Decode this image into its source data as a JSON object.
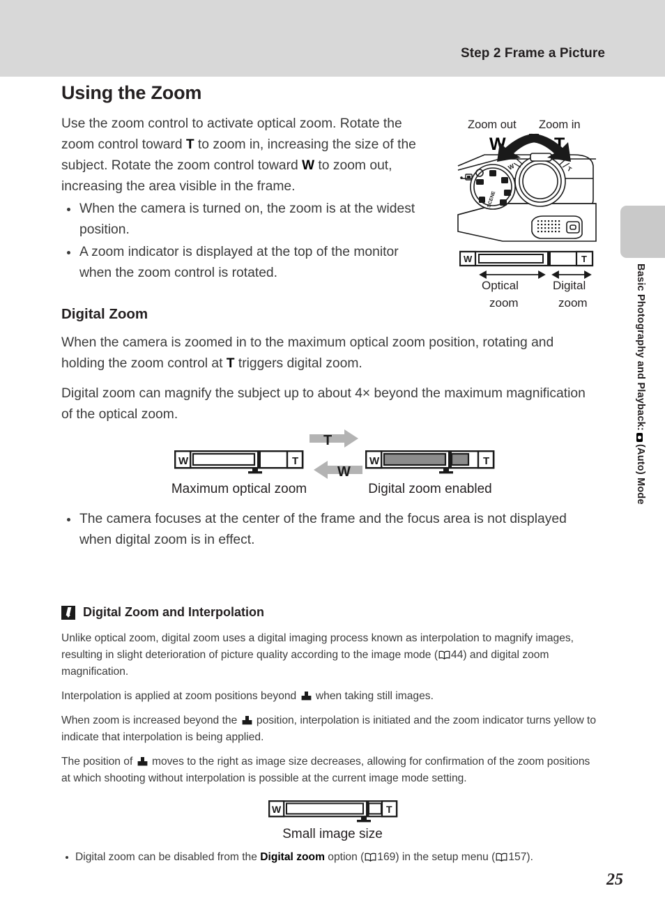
{
  "header": {
    "title": "Step 2 Frame a Picture"
  },
  "sidebar": {
    "chapter_pre": "Basic Photography and Playback: ",
    "chapter_post": " (Auto) Mode",
    "camera_icon": "camera-auto-icon"
  },
  "page": {
    "number": "25"
  },
  "main": {
    "section_title": "Using the Zoom",
    "intro": {
      "part1": "Use the zoom control to activate optical zoom. Rotate the zoom control toward ",
      "letter_t": "T",
      "part2": " to zoom in, increasing the size of the subject. Rotate the zoom control toward ",
      "letter_w": "W",
      "part3": " to zoom out, increasing the area visible in the frame."
    },
    "intro_bullets": [
      "When the camera is turned on, the zoom is at the widest position.",
      "A zoom indicator is displayed at the top of the monitor when the zoom control is rotated."
    ],
    "digital_zoom": {
      "title": "Digital Zoom",
      "para1_a": "When the camera is zoomed in to the maximum optical zoom position, rotating and holding the zoom control at ",
      "para1_letter": "T",
      "para1_b": " triggers digital zoom.",
      "para2": "Digital zoom can magnify the subject up to about 4× beyond the maximum magnification of the optical zoom."
    },
    "digital_bullets": [
      "The camera focuses at the center of the frame and the focus area is not displayed when digital zoom is in effect."
    ]
  },
  "camera_figure": {
    "label_zoom_out": "Zoom out",
    "label_zoom_in": "Zoom in",
    "letter_w": "W",
    "letter_t": "T",
    "bar_w": "W",
    "bar_t": "T",
    "optical_label_line1": "Optical",
    "optical_label_line2": "zoom",
    "digital_label_line1": "Digital",
    "digital_label_line2": "zoom"
  },
  "zoom_diagrams": {
    "left": {
      "caption": "Maximum optical zoom",
      "w": "W",
      "t": "T"
    },
    "right": {
      "caption": "Digital zoom enabled",
      "w": "W",
      "t": "T"
    },
    "arrow_t": "T",
    "arrow_w": "W",
    "small": {
      "caption": "Small image size",
      "w": "W",
      "t": "T"
    }
  },
  "note": {
    "title": "Digital Zoom and Interpolation",
    "icon": "pencil-note-icon",
    "paragraphs": {
      "p1_a": "Unlike optical zoom, digital zoom uses a digital imaging process known as interpolation to magnify images, resulting in slight deterioration of picture quality according to the image mode (",
      "p1_ref": "44",
      "p1_b": ") and digital zoom magnification.",
      "p2_a": "Interpolation is applied at zoom positions beyond ",
      "p2_b": " when taking still images.",
      "p3_a": "When zoom is increased beyond the ",
      "p3_b": " position, interpolation is initiated and the zoom indicator turns yellow to indicate that interpolation is being applied.",
      "p4_a": "The position of ",
      "p4_b": " moves to the right as image size decreases, allowing for confirmation of the zoom positions at which shooting without interpolation is possible at the current image mode setting."
    },
    "bullet": {
      "a": "Digital zoom can be disabled from the ",
      "bold": "Digital zoom",
      "b": " option (",
      "ref1": "169",
      "c": ") in the setup menu (",
      "ref2": "157",
      "d": ")."
    }
  },
  "colors": {
    "header_band": "#d8d8d8",
    "side_tab": "#c9c9c9",
    "bar_fill": "#8c8c8c",
    "arrow_gray": "#b3b3b3",
    "text": "#231f20"
  }
}
